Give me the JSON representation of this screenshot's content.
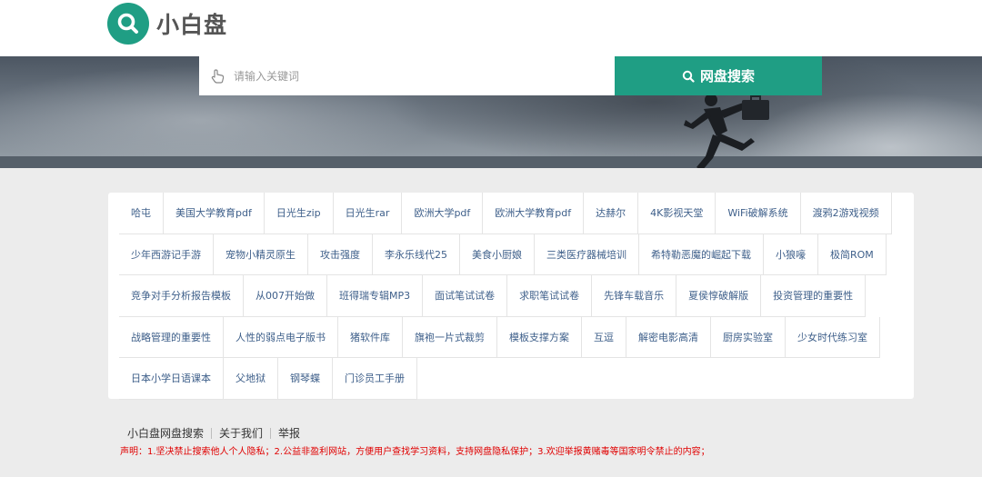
{
  "header": {
    "site_name": "小白盘"
  },
  "search": {
    "placeholder": "请输入关键词",
    "button_label": "网盘搜索"
  },
  "tags": [
    "哈屯",
    "美国大学教育pdf",
    "日光生zip",
    "日光生rar",
    "欧洲大学pdf",
    "欧洲大学教育pdf",
    "达赫尔",
    "4K影视天堂",
    "WiFi破解系统",
    "渡鸦2游戏视频",
    "少年西游记手游",
    "宠物小精灵原生",
    "攻击强度",
    "李永乐线代25",
    "美食小厨娘",
    "三类医疗器械培训",
    "希特勒恶魔的崛起下载",
    "小狼嚎",
    "极简ROM",
    "竞争对手分析报告模板",
    "从007开始做",
    "班得瑞专辑MP3",
    "面试笔试试卷",
    "求职笔试试卷",
    "先锋车载音乐",
    "夏侯惇破解版",
    "投资管理的重要性",
    "战略管理的重要性",
    "人性的弱点电子版书",
    "猪软件库",
    "旗袍一片式裁剪",
    "模板支撑方案",
    "互逗",
    "解密电影高清",
    "厨房实验室",
    "少女时代练习室",
    "日本小学日语课本",
    "父地狱",
    "钢琴蝶",
    "门诊员工手册"
  ],
  "footer": {
    "links": [
      "小白盘网盘搜索",
      "关于我们",
      "举报"
    ],
    "notice": "声明：1.坚决禁止搜索他人个人隐私；2.公益非盈利网站，方便用户查找学习资料，支持网盘隐私保护；3.欢迎举报黄赌毒等国家明令禁止的内容；"
  },
  "colors": {
    "accent": "#1f9e84",
    "tag_text": "#3e5f8a",
    "notice_text": "#e00000",
    "page_bg": "#ececec"
  },
  "icons": {
    "logo": "search-icon",
    "search_field": "hand-icon",
    "search_button": "search-icon"
  }
}
